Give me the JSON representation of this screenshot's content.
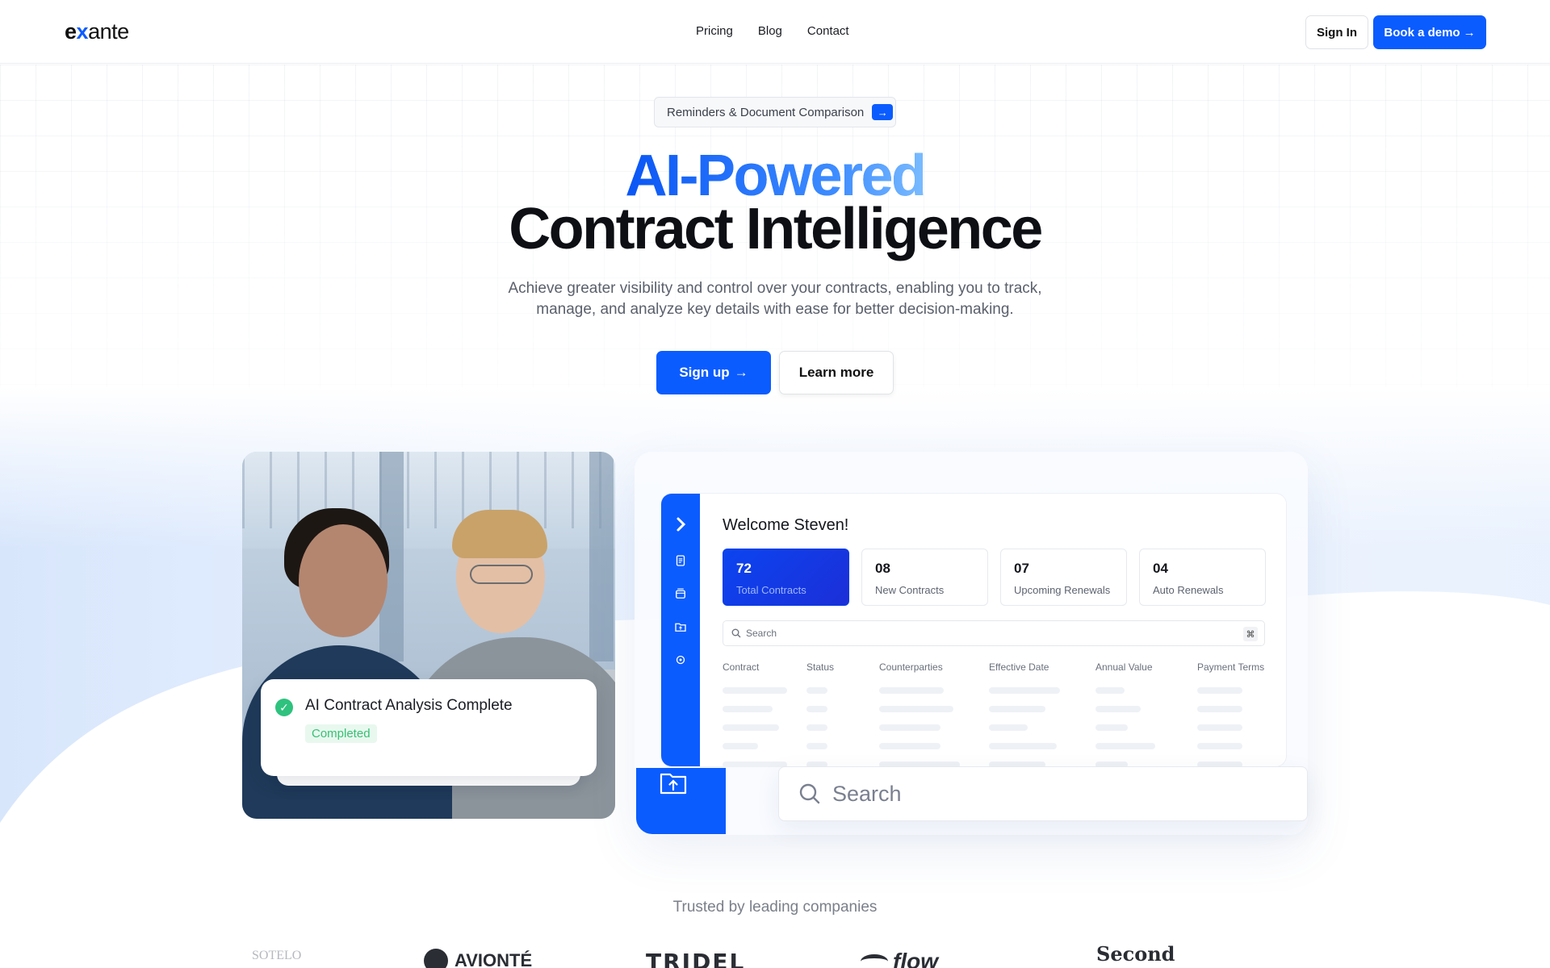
{
  "brand": {
    "logo_ex": "e",
    "logo_x": "x",
    "logo_rest": "ante"
  },
  "nav": {
    "items": [
      "Pricing",
      "Blog",
      "Contact"
    ]
  },
  "header": {
    "signin_label": "Sign In",
    "demo_label": "Book a demo",
    "demo_arrow": "→"
  },
  "hero": {
    "pill_text": "Reminders & Document Comparison",
    "pill_arrow": "→",
    "title_line1": "AI-Powered",
    "title_line2": "Contract Intelligence",
    "subtitle": "Achieve greater visibility and control over your contracts, enabling you to track, manage, and analyze key details with ease for better decision-making.",
    "signup_label": "Sign up",
    "signup_arrow": "→",
    "learn_label": "Learn more"
  },
  "notification": {
    "title": "AI Contract Analysis Complete",
    "status": "Completed"
  },
  "dashboard": {
    "welcome": "Welcome Steven!",
    "stats": [
      {
        "num": "72",
        "label": "Total Contracts"
      },
      {
        "num": "08",
        "label": "New Contracts"
      },
      {
        "num": "07",
        "label": "Upcoming Renewals"
      },
      {
        "num": "04",
        "label": "Auto Renewals"
      }
    ],
    "search_placeholder": "Search",
    "search_kbd": "⌘",
    "columns": [
      "Contract",
      "Status",
      "Counterparties",
      "Effective Date",
      "Annual Value",
      "Payment Terms"
    ],
    "sidebar_icons": [
      "chevron-right-icon",
      "document-icon",
      "archive-icon",
      "folder-upload-icon",
      "settings-icon"
    ]
  },
  "big_search": {
    "placeholder": "Search"
  },
  "trusted": {
    "label": "Trusted by leading companies",
    "logos": [
      "SOTELO",
      "AVIONTÉ",
      "TRIDEL",
      "flow",
      "Second"
    ]
  },
  "colors": {
    "accent": "#0b5cff",
    "success": "#2ec27e"
  }
}
